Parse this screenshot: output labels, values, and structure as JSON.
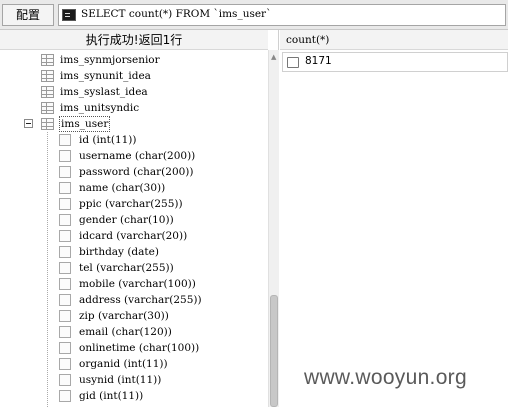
{
  "toolbar": {
    "config_label": "配置",
    "sql_query": "SELECT count(*) FROM `ims_user`"
  },
  "left_pane": {
    "status": "执行成功!返回1行",
    "tables_before": [
      "ims_synmjorsenior",
      "ims_synunit_idea",
      "ims_syslast_idea",
      "ims_unitsyndic"
    ],
    "expanded_table": "ims_user",
    "columns": [
      "id (int(11))",
      "username (char(200))",
      "password (char(200))",
      "name (char(30))",
      "ppic (varchar(255))",
      "gender (char(10))",
      "idcard (varchar(20))",
      "birthday (date)",
      "tel (varchar(255))",
      "mobile (varchar(100))",
      "address (varchar(255))",
      "zip (varchar(30))",
      "email (char(120))",
      "onlinetime (char(100))",
      "organid (int(11))",
      "usynid (int(11))",
      "gid (int(11))"
    ]
  },
  "result": {
    "column_header": "count(*)",
    "value": "8171"
  },
  "watermark": "www.wooyun.org"
}
